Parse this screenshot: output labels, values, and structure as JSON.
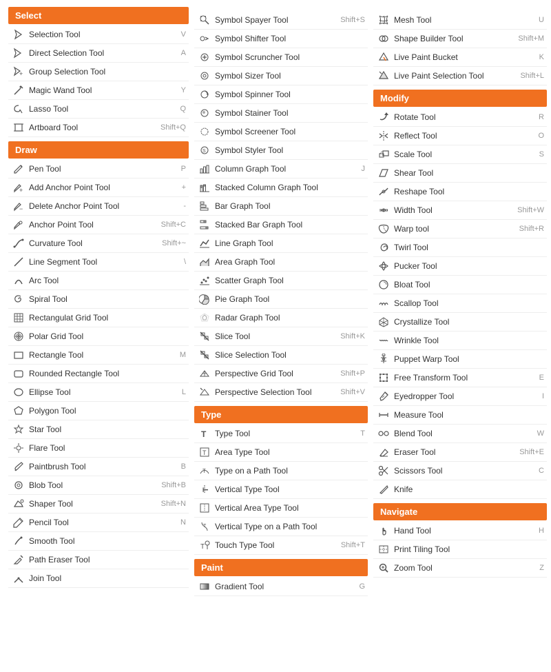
{
  "columns": [
    {
      "sections": [
        {
          "header": "Select",
          "tools": [
            {
              "name": "Selection Tool",
              "shortcut": "V",
              "icon": "arrow"
            },
            {
              "name": "Direct Selection Tool",
              "shortcut": "A",
              "icon": "arrow-hollow"
            },
            {
              "name": "Group Selection Tool",
              "shortcut": "",
              "icon": "arrow-plus"
            },
            {
              "name": "Magic Wand Tool",
              "shortcut": "Y",
              "icon": "wand"
            },
            {
              "name": "Lasso Tool",
              "shortcut": "Q",
              "icon": "lasso"
            },
            {
              "name": "Artboard Tool",
              "shortcut": "Shift+Q",
              "icon": "artboard"
            }
          ]
        },
        {
          "header": "Draw",
          "tools": [
            {
              "name": "Pen Tool",
              "shortcut": "P",
              "icon": "pen"
            },
            {
              "name": "Add Anchor Point Tool",
              "shortcut": "+",
              "icon": "pen-plus"
            },
            {
              "name": "Delete Anchor Point Tool",
              "shortcut": "-",
              "icon": "pen-minus"
            },
            {
              "name": "Anchor Point Tool",
              "shortcut": "Shift+C",
              "icon": "anchor"
            },
            {
              "name": "Curvature Tool",
              "shortcut": "Shift+~",
              "icon": "curve"
            },
            {
              "name": "Line Segment Tool",
              "shortcut": "\\",
              "icon": "line"
            },
            {
              "name": "Arc Tool",
              "shortcut": "",
              "icon": "arc"
            },
            {
              "name": "Spiral Tool",
              "shortcut": "",
              "icon": "spiral"
            },
            {
              "name": "Rectangulat Grid Tool",
              "shortcut": "",
              "icon": "grid"
            },
            {
              "name": "Polar Grid Tool",
              "shortcut": "",
              "icon": "polargrid"
            },
            {
              "name": "Rectangle Tool",
              "shortcut": "M",
              "icon": "rect"
            },
            {
              "name": "Rounded Rectangle Tool",
              "shortcut": "",
              "icon": "roundrect"
            },
            {
              "name": "Ellipse Tool",
              "shortcut": "L",
              "icon": "ellipse"
            },
            {
              "name": "Polygon Tool",
              "shortcut": "",
              "icon": "polygon"
            },
            {
              "name": "Star Tool",
              "shortcut": "",
              "icon": "star"
            },
            {
              "name": "Flare Tool",
              "shortcut": "",
              "icon": "flare"
            },
            {
              "name": "Paintbrush Tool",
              "shortcut": "B",
              "icon": "brush"
            },
            {
              "name": "Blob Tool",
              "shortcut": "Shift+B",
              "icon": "blob"
            },
            {
              "name": "Shaper Tool",
              "shortcut": "Shift+N",
              "icon": "shaper"
            },
            {
              "name": "Pencil Tool",
              "shortcut": "N",
              "icon": "pencil"
            },
            {
              "name": "Smooth Tool",
              "shortcut": "",
              "icon": "smooth"
            },
            {
              "name": "Path Eraser Tool",
              "shortcut": "",
              "icon": "patheraser"
            },
            {
              "name": "Join Tool",
              "shortcut": "",
              "icon": "join"
            }
          ]
        }
      ]
    },
    {
      "sections": [
        {
          "header": null,
          "tools": [
            {
              "name": "Symbol Spayer Tool",
              "shortcut": "Shift+S",
              "icon": "symbolspray"
            },
            {
              "name": "Symbol Shifter Tool",
              "shortcut": "",
              "icon": "symbolshift"
            },
            {
              "name": "Symbol Scruncher Tool",
              "shortcut": "",
              "icon": "symbolscrunch"
            },
            {
              "name": "Symbol Sizer Tool",
              "shortcut": "",
              "icon": "symbolsize"
            },
            {
              "name": "Symbol Spinner Tool",
              "shortcut": "",
              "icon": "symbolspin"
            },
            {
              "name": "Symbol Stainer Tool",
              "shortcut": "",
              "icon": "symbolstain"
            },
            {
              "name": "Symbol Screener Tool",
              "shortcut": "",
              "icon": "symbolscreen"
            },
            {
              "name": "Symbol Styler Tool",
              "shortcut": "",
              "icon": "symbolstyle"
            },
            {
              "name": "Column Graph Tool",
              "shortcut": "J",
              "icon": "columngraph"
            },
            {
              "name": "Stacked Column Graph Tool",
              "shortcut": "",
              "icon": "stackedcol"
            },
            {
              "name": "Bar Graph Tool",
              "shortcut": "",
              "icon": "bargraph"
            },
            {
              "name": "Stacked Bar Graph Tool",
              "shortcut": "",
              "icon": "stackedbar"
            },
            {
              "name": "Line Graph Tool",
              "shortcut": "",
              "icon": "linegraph"
            },
            {
              "name": "Area Graph Tool",
              "shortcut": "",
              "icon": "areagraph"
            },
            {
              "name": "Scatter Graph Tool",
              "shortcut": "",
              "icon": "scattergraph"
            },
            {
              "name": "Pie Graph Tool",
              "shortcut": "",
              "icon": "piegraph"
            },
            {
              "name": "Radar Graph Tool",
              "shortcut": "",
              "icon": "radargraph"
            },
            {
              "name": "Slice Tool",
              "shortcut": "Shift+K",
              "icon": "slice"
            },
            {
              "name": "Slice Selection Tool",
              "shortcut": "",
              "icon": "slicesel"
            },
            {
              "name": "Perspective Grid Tool",
              "shortcut": "Shift+P",
              "icon": "perspgrid"
            },
            {
              "name": "Perspective Selection Tool",
              "shortcut": "Shift+V",
              "icon": "perspsel"
            }
          ]
        },
        {
          "header": "Type",
          "tools": [
            {
              "name": "Type Tool",
              "shortcut": "T",
              "icon": "type"
            },
            {
              "name": "Area Type Tool",
              "shortcut": "",
              "icon": "areatype"
            },
            {
              "name": "Type on a Path Tool",
              "shortcut": "",
              "icon": "typepath"
            },
            {
              "name": "Vertical Type Tool",
              "shortcut": "",
              "icon": "verttype"
            },
            {
              "name": "Vertical Area Type Tool",
              "shortcut": "",
              "icon": "vertareatype"
            },
            {
              "name": "Vertical Type on a Path Tool",
              "shortcut": "",
              "icon": "verttypepath"
            },
            {
              "name": "Touch Type Tool",
              "shortcut": "Shift+T",
              "icon": "touchtype"
            }
          ]
        },
        {
          "header": "Paint",
          "tools": [
            {
              "name": "Gradient Tool",
              "shortcut": "G",
              "icon": "gradient"
            }
          ]
        }
      ]
    },
    {
      "sections": [
        {
          "header": null,
          "tools": [
            {
              "name": "Mesh Tool",
              "shortcut": "U",
              "icon": "mesh"
            },
            {
              "name": "Shape Builder Tool",
              "shortcut": "Shift+M",
              "icon": "shapebuilder"
            },
            {
              "name": "Live Paint Bucket",
              "shortcut": "K",
              "icon": "livepaint"
            },
            {
              "name": "Live Paint Selection Tool",
              "shortcut": "Shift+L",
              "icon": "livepaintsel"
            }
          ]
        },
        {
          "header": "Modify",
          "tools": [
            {
              "name": "Rotate Tool",
              "shortcut": "R",
              "icon": "rotate"
            },
            {
              "name": "Reflect Tool",
              "shortcut": "O",
              "icon": "reflect"
            },
            {
              "name": "Scale Tool",
              "shortcut": "S",
              "icon": "scale"
            },
            {
              "name": "Shear Tool",
              "shortcut": "",
              "icon": "shear"
            },
            {
              "name": "Reshape Tool",
              "shortcut": "",
              "icon": "reshape"
            },
            {
              "name": "Width Tool",
              "shortcut": "Shift+W",
              "icon": "width"
            },
            {
              "name": "Warp tool",
              "shortcut": "Shift+R",
              "icon": "warp"
            },
            {
              "name": "Twirl Tool",
              "shortcut": "",
              "icon": "twirl"
            },
            {
              "name": "Pucker Tool",
              "shortcut": "",
              "icon": "pucker"
            },
            {
              "name": "Bloat Tool",
              "shortcut": "",
              "icon": "bloat"
            },
            {
              "name": "Scallop Tool",
              "shortcut": "",
              "icon": "scallop"
            },
            {
              "name": "Crystallize Tool",
              "shortcut": "",
              "icon": "crystallize"
            },
            {
              "name": "Wrinkle Tool",
              "shortcut": "",
              "icon": "wrinkle"
            },
            {
              "name": "Puppet Warp Tool",
              "shortcut": "",
              "icon": "puppetwarp"
            },
            {
              "name": "Free Transform Tool",
              "shortcut": "E",
              "icon": "freetransform"
            },
            {
              "name": "Eyedropper Tool",
              "shortcut": "I",
              "icon": "eyedropper"
            },
            {
              "name": "Measure Tool",
              "shortcut": "",
              "icon": "measure"
            },
            {
              "name": "Blend Tool",
              "shortcut": "W",
              "icon": "blend"
            },
            {
              "name": "Eraser Tool",
              "shortcut": "Shift+E",
              "icon": "eraser"
            },
            {
              "name": "Scissors Tool",
              "shortcut": "C",
              "icon": "scissors"
            },
            {
              "name": "Knife",
              "shortcut": "",
              "icon": "knife"
            }
          ]
        },
        {
          "header": "Navigate",
          "tools": [
            {
              "name": "Hand Tool",
              "shortcut": "H",
              "icon": "hand"
            },
            {
              "name": "Print Tiling Tool",
              "shortcut": "",
              "icon": "printtile"
            },
            {
              "name": "Zoom Tool",
              "shortcut": "Z",
              "icon": "zoom"
            }
          ]
        }
      ]
    }
  ]
}
